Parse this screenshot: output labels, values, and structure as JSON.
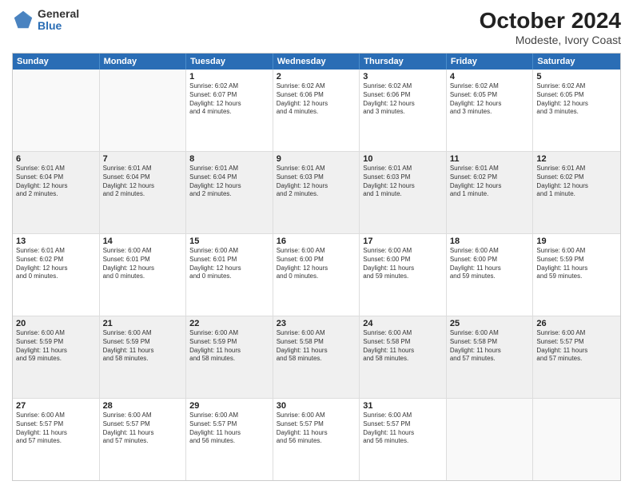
{
  "header": {
    "logo": {
      "general": "General",
      "blue": "Blue"
    },
    "title": "October 2024",
    "subtitle": "Modeste, Ivory Coast"
  },
  "weekdays": [
    "Sunday",
    "Monday",
    "Tuesday",
    "Wednesday",
    "Thursday",
    "Friday",
    "Saturday"
  ],
  "weeks": [
    [
      {
        "day": "",
        "info": "",
        "shaded": false,
        "empty": true
      },
      {
        "day": "",
        "info": "",
        "shaded": false,
        "empty": true
      },
      {
        "day": "1",
        "info": "Sunrise: 6:02 AM\nSunset: 6:07 PM\nDaylight: 12 hours\nand 4 minutes.",
        "shaded": false,
        "empty": false
      },
      {
        "day": "2",
        "info": "Sunrise: 6:02 AM\nSunset: 6:06 PM\nDaylight: 12 hours\nand 4 minutes.",
        "shaded": false,
        "empty": false
      },
      {
        "day": "3",
        "info": "Sunrise: 6:02 AM\nSunset: 6:06 PM\nDaylight: 12 hours\nand 3 minutes.",
        "shaded": false,
        "empty": false
      },
      {
        "day": "4",
        "info": "Sunrise: 6:02 AM\nSunset: 6:05 PM\nDaylight: 12 hours\nand 3 minutes.",
        "shaded": false,
        "empty": false
      },
      {
        "day": "5",
        "info": "Sunrise: 6:02 AM\nSunset: 6:05 PM\nDaylight: 12 hours\nand 3 minutes.",
        "shaded": false,
        "empty": false
      }
    ],
    [
      {
        "day": "6",
        "info": "Sunrise: 6:01 AM\nSunset: 6:04 PM\nDaylight: 12 hours\nand 2 minutes.",
        "shaded": true,
        "empty": false
      },
      {
        "day": "7",
        "info": "Sunrise: 6:01 AM\nSunset: 6:04 PM\nDaylight: 12 hours\nand 2 minutes.",
        "shaded": true,
        "empty": false
      },
      {
        "day": "8",
        "info": "Sunrise: 6:01 AM\nSunset: 6:04 PM\nDaylight: 12 hours\nand 2 minutes.",
        "shaded": true,
        "empty": false
      },
      {
        "day": "9",
        "info": "Sunrise: 6:01 AM\nSunset: 6:03 PM\nDaylight: 12 hours\nand 2 minutes.",
        "shaded": true,
        "empty": false
      },
      {
        "day": "10",
        "info": "Sunrise: 6:01 AM\nSunset: 6:03 PM\nDaylight: 12 hours\nand 1 minute.",
        "shaded": true,
        "empty": false
      },
      {
        "day": "11",
        "info": "Sunrise: 6:01 AM\nSunset: 6:02 PM\nDaylight: 12 hours\nand 1 minute.",
        "shaded": true,
        "empty": false
      },
      {
        "day": "12",
        "info": "Sunrise: 6:01 AM\nSunset: 6:02 PM\nDaylight: 12 hours\nand 1 minute.",
        "shaded": true,
        "empty": false
      }
    ],
    [
      {
        "day": "13",
        "info": "Sunrise: 6:01 AM\nSunset: 6:02 PM\nDaylight: 12 hours\nand 0 minutes.",
        "shaded": false,
        "empty": false
      },
      {
        "day": "14",
        "info": "Sunrise: 6:00 AM\nSunset: 6:01 PM\nDaylight: 12 hours\nand 0 minutes.",
        "shaded": false,
        "empty": false
      },
      {
        "day": "15",
        "info": "Sunrise: 6:00 AM\nSunset: 6:01 PM\nDaylight: 12 hours\nand 0 minutes.",
        "shaded": false,
        "empty": false
      },
      {
        "day": "16",
        "info": "Sunrise: 6:00 AM\nSunset: 6:00 PM\nDaylight: 12 hours\nand 0 minutes.",
        "shaded": false,
        "empty": false
      },
      {
        "day": "17",
        "info": "Sunrise: 6:00 AM\nSunset: 6:00 PM\nDaylight: 11 hours\nand 59 minutes.",
        "shaded": false,
        "empty": false
      },
      {
        "day": "18",
        "info": "Sunrise: 6:00 AM\nSunset: 6:00 PM\nDaylight: 11 hours\nand 59 minutes.",
        "shaded": false,
        "empty": false
      },
      {
        "day": "19",
        "info": "Sunrise: 6:00 AM\nSunset: 5:59 PM\nDaylight: 11 hours\nand 59 minutes.",
        "shaded": false,
        "empty": false
      }
    ],
    [
      {
        "day": "20",
        "info": "Sunrise: 6:00 AM\nSunset: 5:59 PM\nDaylight: 11 hours\nand 59 minutes.",
        "shaded": true,
        "empty": false
      },
      {
        "day": "21",
        "info": "Sunrise: 6:00 AM\nSunset: 5:59 PM\nDaylight: 11 hours\nand 58 minutes.",
        "shaded": true,
        "empty": false
      },
      {
        "day": "22",
        "info": "Sunrise: 6:00 AM\nSunset: 5:59 PM\nDaylight: 11 hours\nand 58 minutes.",
        "shaded": true,
        "empty": false
      },
      {
        "day": "23",
        "info": "Sunrise: 6:00 AM\nSunset: 5:58 PM\nDaylight: 11 hours\nand 58 minutes.",
        "shaded": true,
        "empty": false
      },
      {
        "day": "24",
        "info": "Sunrise: 6:00 AM\nSunset: 5:58 PM\nDaylight: 11 hours\nand 58 minutes.",
        "shaded": true,
        "empty": false
      },
      {
        "day": "25",
        "info": "Sunrise: 6:00 AM\nSunset: 5:58 PM\nDaylight: 11 hours\nand 57 minutes.",
        "shaded": true,
        "empty": false
      },
      {
        "day": "26",
        "info": "Sunrise: 6:00 AM\nSunset: 5:57 PM\nDaylight: 11 hours\nand 57 minutes.",
        "shaded": true,
        "empty": false
      }
    ],
    [
      {
        "day": "27",
        "info": "Sunrise: 6:00 AM\nSunset: 5:57 PM\nDaylight: 11 hours\nand 57 minutes.",
        "shaded": false,
        "empty": false
      },
      {
        "day": "28",
        "info": "Sunrise: 6:00 AM\nSunset: 5:57 PM\nDaylight: 11 hours\nand 57 minutes.",
        "shaded": false,
        "empty": false
      },
      {
        "day": "29",
        "info": "Sunrise: 6:00 AM\nSunset: 5:57 PM\nDaylight: 11 hours\nand 56 minutes.",
        "shaded": false,
        "empty": false
      },
      {
        "day": "30",
        "info": "Sunrise: 6:00 AM\nSunset: 5:57 PM\nDaylight: 11 hours\nand 56 minutes.",
        "shaded": false,
        "empty": false
      },
      {
        "day": "31",
        "info": "Sunrise: 6:00 AM\nSunset: 5:57 PM\nDaylight: 11 hours\nand 56 minutes.",
        "shaded": false,
        "empty": false
      },
      {
        "day": "",
        "info": "",
        "shaded": false,
        "empty": true
      },
      {
        "day": "",
        "info": "",
        "shaded": false,
        "empty": true
      }
    ]
  ]
}
